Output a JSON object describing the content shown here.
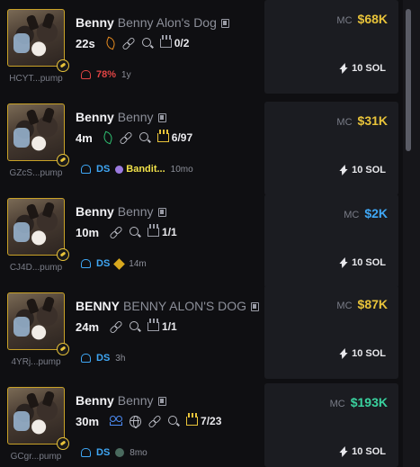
{
  "tokens": [
    {
      "ticker": "Benny",
      "name": "Benny Alon's Dog",
      "address": "HCYT...pump",
      "age": "22s",
      "socials_type": "orange-leaf",
      "top_holders": "0/2",
      "crown_gold": false,
      "holders_pct": "78%",
      "time": "1y",
      "dev_label": "",
      "mc_label": "MC",
      "mc_value": "$68K",
      "mc_color": "#e8c33a",
      "sol": "10 SOL"
    },
    {
      "ticker": "Benny",
      "name": "Benny",
      "address": "GZcS...pump",
      "age": "4m",
      "socials_type": "green-leaf",
      "top_holders": "6/97",
      "crown_gold": true,
      "ds": "DS",
      "user": "Bandit...",
      "time": "10mo",
      "mc_label": "MC",
      "mc_value": "$31K",
      "mc_color": "#e8c33a",
      "sol": "10 SOL"
    },
    {
      "ticker": "Benny",
      "name": "Benny",
      "address": "CJ4D...pump",
      "age": "10m",
      "top_holders": "1/1",
      "crown_gold": false,
      "ds": "DS",
      "time": "14m",
      "mc_label": "MC",
      "mc_value": "$2K",
      "mc_color": "#3fa7f5",
      "sol": "10 SOL"
    },
    {
      "ticker": "BENNY",
      "name": "BENNY ALON'S DOG",
      "address": "4YRj...pump",
      "age": "24m",
      "top_holders": "1/1",
      "crown_gold": false,
      "ds": "DS",
      "time": "3h",
      "mc_label": "MC",
      "mc_value": "$87K",
      "mc_color": "#e8c33a",
      "sol": "10 SOL"
    },
    {
      "ticker": "Benny",
      "name": "Benny",
      "address": "GCgr...pump",
      "age": "30m",
      "top_holders": "7/23",
      "crown_gold": true,
      "ds": "DS",
      "time": "8mo",
      "mc_label": "MC",
      "mc_value": "$193K",
      "mc_color": "#3ad29f",
      "sol": "10 SOL"
    }
  ]
}
